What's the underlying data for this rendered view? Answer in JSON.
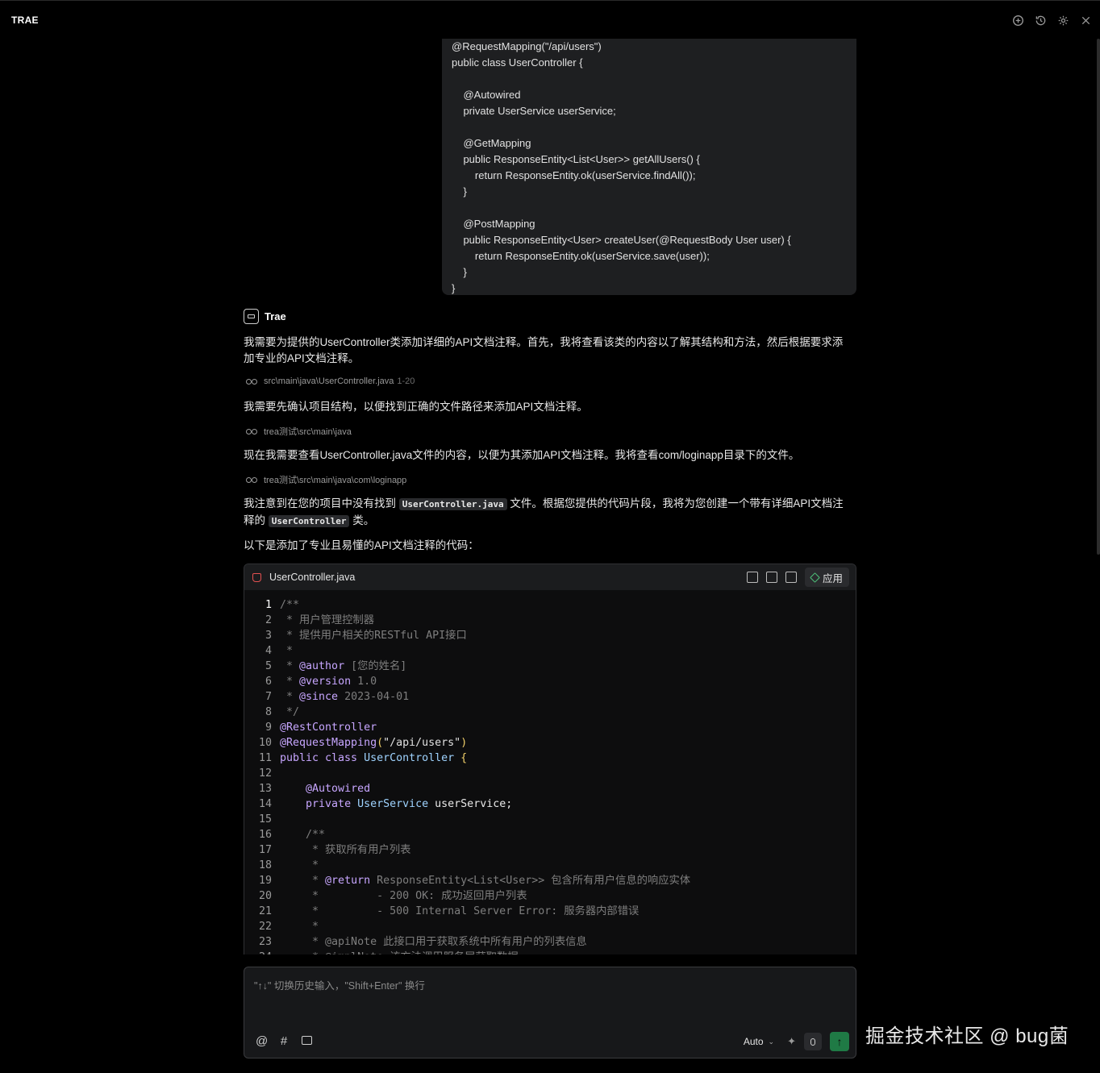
{
  "window": {
    "title": "TRAE",
    "icons": [
      "add-chat-icon",
      "history-icon",
      "settings-icon",
      "close-icon"
    ]
  },
  "user_code": {
    "lines": [
      "@RequestMapping(\"/api/users\")",
      "public class UserController {",
      "",
      "    @Autowired",
      "    private UserService userService;",
      "",
      "    @GetMapping",
      "    public ResponseEntity<List<User>> getAllUsers() {",
      "        return ResponseEntity.ok(userService.findAll());",
      "    }",
      "",
      "    @PostMapping",
      "    public ResponseEntity<User> createUser(@RequestBody User user) {",
      "        return ResponseEntity.ok(userService.save(user));",
      "    }",
      "}"
    ]
  },
  "assistant": {
    "name": "Trae",
    "msg1": "我需要为提供的UserController类添加详细的API文档注释。首先，我将查看该类的内容以了解其结构和方法，然后根据要求添加专业的API文档注释。",
    "ref1_path": "src\\main\\java\\UserController.java",
    "ref1_range": "1-20",
    "msg2": "我需要先确认项目结构，以便找到正确的文件路径来添加API文档注释。",
    "ref2_path": "trea测试\\src\\main\\java",
    "msg3": "现在我需要查看UserController.java文件的内容，以便为其添加API文档注释。我将查看com/loginapp目录下的文件。",
    "ref3_path": "trea测试\\src\\main\\java\\com\\loginapp",
    "msg4_a": "我注意到在您的项目中没有找到",
    "msg4_code1": "UserController.java",
    "msg4_b": "文件。根据您提供的代码片段，我将为您创建一个带有详细API文档注释的",
    "msg4_code2": "UserController",
    "msg4_c": "类。",
    "msg5": "以下是添加了专业且易懂的API文档注释的代码："
  },
  "code_block": {
    "file_name": "UserController.java",
    "apply_label": "应用",
    "current_line": 1,
    "lines": [
      [
        [
          "c-com",
          "/**"
        ]
      ],
      [
        [
          "c-com",
          " * 用户管理控制器"
        ]
      ],
      [
        [
          "c-com",
          " * 提供用户相关的RESTful API接口"
        ]
      ],
      [
        [
          "c-com",
          " *"
        ]
      ],
      [
        [
          "c-com",
          " * "
        ],
        [
          "c-jd",
          "@author"
        ],
        [
          "c-com",
          " [您的姓名]"
        ]
      ],
      [
        [
          "c-com",
          " * "
        ],
        [
          "c-jd",
          "@version"
        ],
        [
          "c-com",
          " 1.0"
        ]
      ],
      [
        [
          "c-com",
          " * "
        ],
        [
          "c-jd",
          "@since"
        ],
        [
          "c-com",
          " 2023-04-01"
        ]
      ],
      [
        [
          "c-com",
          " */"
        ]
      ],
      [
        [
          "c-ann",
          "@RestController"
        ]
      ],
      [
        [
          "c-ann",
          "@RequestMapping"
        ],
        [
          "c-yb",
          "("
        ],
        [
          "c-str",
          "\"/api/users\""
        ],
        [
          "c-yb",
          ")"
        ]
      ],
      [
        [
          "c-kw",
          "public class "
        ],
        [
          "c-cls",
          "UserController "
        ],
        [
          "c-yb",
          "{"
        ]
      ],
      [
        [
          "c-pl",
          ""
        ]
      ],
      [
        [
          "c-pl",
          "    "
        ],
        [
          "c-ann",
          "@Autowired"
        ]
      ],
      [
        [
          "c-pl",
          "    "
        ],
        [
          "c-kw",
          "private "
        ],
        [
          "c-cls",
          "UserService "
        ],
        [
          "c-pl",
          "userService;"
        ]
      ],
      [
        [
          "c-pl",
          ""
        ]
      ],
      [
        [
          "c-com",
          "    /**"
        ]
      ],
      [
        [
          "c-com",
          "     * 获取所有用户列表"
        ]
      ],
      [
        [
          "c-com",
          "     *"
        ]
      ],
      [
        [
          "c-com",
          "     * "
        ],
        [
          "c-jd",
          "@return"
        ],
        [
          "c-com",
          " ResponseEntity<List<User>> 包含所有用户信息的响应实体"
        ]
      ],
      [
        [
          "c-com",
          "     *         - 200 OK: 成功返回用户列表"
        ]
      ],
      [
        [
          "c-com",
          "     *         - 500 Internal Server Error: 服务器内部错误"
        ]
      ],
      [
        [
          "c-com",
          "     *"
        ]
      ],
      [
        [
          "c-com",
          "     * @apiNote 此接口用于获取系统中所有用户的列表信息"
        ]
      ],
      [
        [
          "c-com",
          "     * @implNote 该方法调用服务层获取数据"
        ]
      ]
    ]
  },
  "input": {
    "placeholder": "\"↑↓\" 切换历史输入，\"Shift+Enter\" 换行",
    "left_icons": [
      "@",
      "#"
    ],
    "model": "Auto"
  },
  "watermark": "掘金技术社区 @ bug菌"
}
